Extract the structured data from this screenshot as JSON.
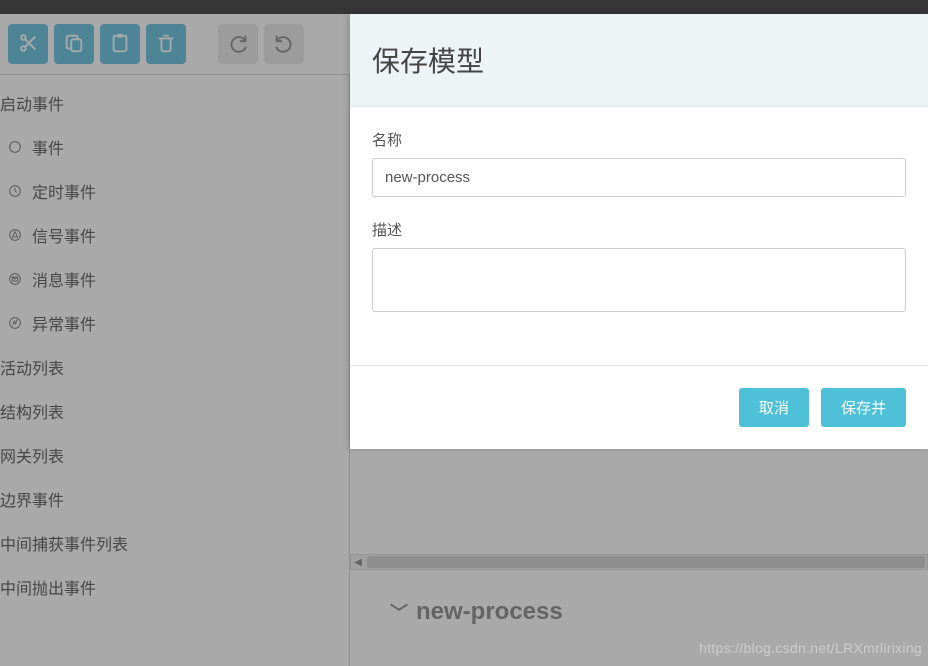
{
  "toolbar": {
    "cut": "cut",
    "copy": "copy",
    "paste": "paste",
    "delete": "delete",
    "redo": "redo",
    "undo": "undo"
  },
  "sidebar": {
    "start_events_header": "启动事件",
    "items": [
      {
        "label": "事件",
        "icon": "circle"
      },
      {
        "label": "定时事件",
        "icon": "timer"
      },
      {
        "label": "信号事件",
        "icon": "signal"
      },
      {
        "label": "消息事件",
        "icon": "message"
      },
      {
        "label": "异常事件",
        "icon": "error"
      }
    ],
    "headers": [
      "活动列表",
      "结构列表",
      "网关列表",
      "边界事件",
      "中间捕获事件列表",
      "中间抛出事件"
    ]
  },
  "canvas": {
    "process_name": "new-process"
  },
  "modal": {
    "title": "保存模型",
    "name_label": "名称",
    "name_value": "new-process",
    "desc_label": "描述",
    "desc_value": "",
    "cancel_label": "取消",
    "save_label": "保存并"
  },
  "watermark": "https://blog.csdn.net/LRXmrlirixing"
}
